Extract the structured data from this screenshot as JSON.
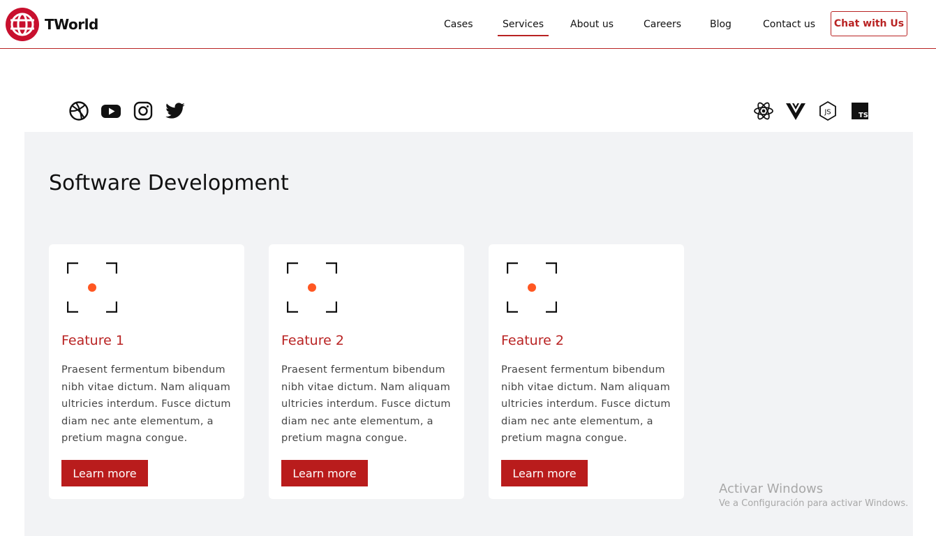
{
  "brand": {
    "name": "TWorld",
    "color": "#b92323"
  },
  "nav": {
    "links": [
      "Cases",
      "Services",
      "About us",
      "Careers",
      "Blog",
      "Contact us"
    ],
    "active": "Services",
    "cta": "Chat with Us"
  },
  "social_icons": [
    "dribbble-icon",
    "youtube-icon",
    "instagram-icon",
    "twitter-icon"
  ],
  "tech_icons": [
    "react-icon",
    "vue-icon",
    "nodejs-icon",
    "typescript-icon"
  ],
  "tech_icon_labels": {
    "nodejs": "JS",
    "typescript": "TS"
  },
  "section": {
    "title": "Software Development",
    "cards": [
      {
        "title": "Feature 1",
        "body": "Praesent fermentum bibendum nibh vitae dictum. Nam aliquam ultricies interdum. Fusce dictum diam nec ante elementum, a pretium magna congue.",
        "button": "Learn more"
      },
      {
        "title": "Feature 2",
        "body": "Praesent fermentum bibendum nibh vitae dictum. Nam aliquam ultricies interdum. Fusce dictum diam nec ante elementum, a pretium magna congue.",
        "button": "Learn more"
      },
      {
        "title": "Feature 2",
        "body": "Praesent fermentum bibendum nibh vitae dictum. Nam aliquam ultricies interdum. Fusce dictum diam nec ante elementum, a pretium magna congue.",
        "button": "Learn more"
      }
    ]
  },
  "colors": {
    "accent": "#b92323",
    "focus_dot": "#ff5722",
    "section_bg": "#f2f3f5"
  },
  "watermark": {
    "line1": "Activar Windows",
    "line2": "Ve a Configuración para activar Windows."
  }
}
